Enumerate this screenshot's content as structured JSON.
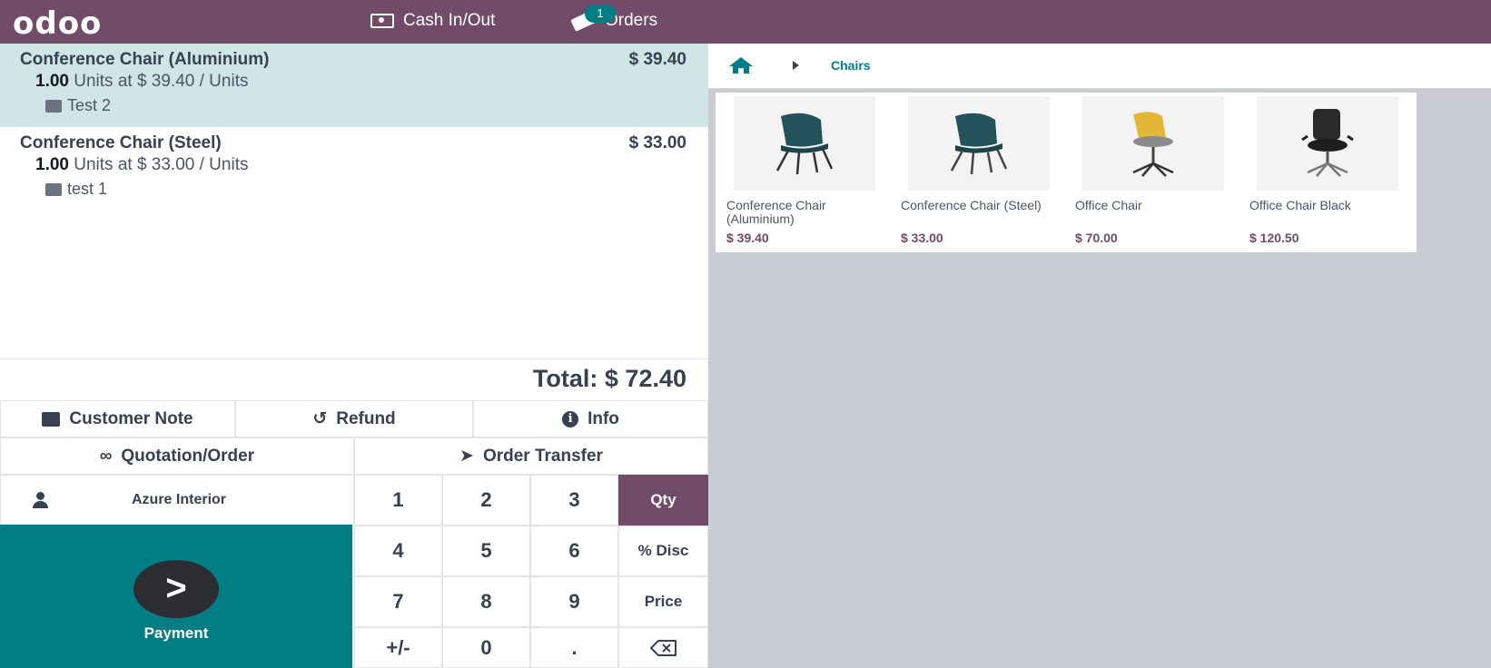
{
  "topbar": {
    "logo": "odoo",
    "cash_label": "Cash In/Out",
    "orders_label": "Orders",
    "orders_badge": "1"
  },
  "order": {
    "lines": [
      {
        "name": "Conference Chair (Aluminium)",
        "price": "$ 39.40",
        "qty": "1.00",
        "unit_text": "Units at $ 39.40 / Units",
        "note": "Test 2",
        "selected": true
      },
      {
        "name": "Conference Chair (Steel)",
        "price": "$ 33.00",
        "qty": "1.00",
        "unit_text": "Units at $ 33.00 / Units",
        "note": "test 1",
        "selected": false
      }
    ],
    "total": "Total: $ 72.40"
  },
  "controls": {
    "customer_note": "Customer Note",
    "refund": "Refund",
    "info": "Info",
    "quotation": "Quotation/Order",
    "order_transfer": "Order Transfer",
    "customer": "Azure Interior",
    "payment": "Payment",
    "pay_glyph": ">"
  },
  "numpad": {
    "keys": [
      "1",
      "2",
      "3",
      "4",
      "5",
      "6",
      "7",
      "8",
      "9",
      "+/-",
      "0",
      "."
    ],
    "modes": [
      "Qty",
      "% Disc",
      "Price"
    ],
    "active_mode": "Qty",
    "backspace_icon": "backspace-icon"
  },
  "products": {
    "breadcrumb": "Chairs",
    "items": [
      {
        "name": "Conference Chair (Aluminium)",
        "price": "$ 39.40",
        "image": "blue-chair"
      },
      {
        "name": "Conference Chair (Steel)",
        "price": "$ 33.00",
        "image": "blue-chair"
      },
      {
        "name": "Office Chair",
        "price": "$ 70.00",
        "image": "yellow-swivel-chair"
      },
      {
        "name": "Office Chair Black",
        "price": "$ 120.50",
        "image": "black-office-chair"
      }
    ]
  },
  "colors": {
    "brand": "#714b67",
    "accent": "#017e84",
    "selected_line": "#cfe5e6"
  }
}
